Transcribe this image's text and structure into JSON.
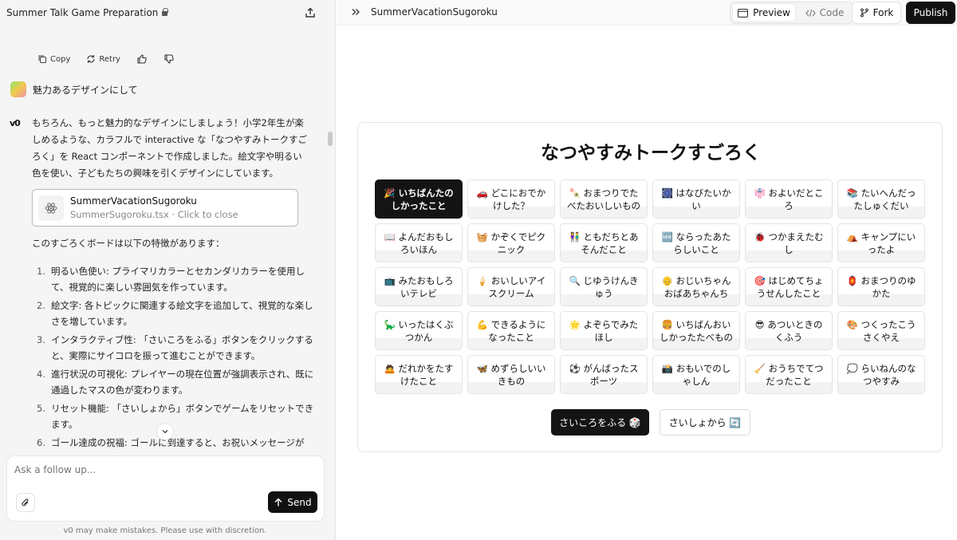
{
  "chat": {
    "title": "Summer Talk Game Preparation",
    "actions": {
      "copy": "Copy",
      "retry": "Retry"
    },
    "user_message": "魅力あるデザインにして",
    "assistant_logo": "v0",
    "assistant_message": "もちろん、もっと魅力的なデザインにしましょう！小学2年生が楽しめるような、カラフルで interactive な「なつやすみトークすごろく」を React コンポーネントで作成しました。絵文字や明るい色を使い、子どもたちの興味を引くデザインにしています。",
    "file_card": {
      "name": "SummerVacationSugoroku",
      "sub": "SummerSugoroku.tsx · Click to close"
    },
    "features_intro": "このすごろくボードは以下の特徴があります：",
    "features": [
      {
        "num": "1.",
        "text": "明るい色使い: プライマリカラーとセカンダリカラーを使用して、視覚的に楽しい雰囲気を作っています。"
      },
      {
        "num": "2.",
        "text": "絵文字: 各トピックに関連する絵文字を追加して、視覚的な楽しさを増しています。"
      },
      {
        "num": "3.",
        "text": "インタラクティブ性: 「さいころをふる」ボタンをクリックすると、実際にサイコロを振って進むことができます。"
      },
      {
        "num": "4.",
        "text": "進行状況の可視化: プレイヤーの現在位置が強調表示され、既に通過したマスの色が変わります。"
      },
      {
        "num": "5.",
        "text": "リセット機能: 「さいしょから」ボタンでゲームをリセットできます。"
      },
      {
        "num": "6.",
        "text": "ゴール達成の祝福: ゴールに到達すると、お祝いメッセージが"
      }
    ],
    "composer_placeholder": "Ask a follow up...",
    "send_label": "Send",
    "disclaimer": "v0 may make mistakes. Please use with discretion."
  },
  "preview": {
    "title": "SummerVacationSugoroku",
    "tabs": {
      "preview": "Preview",
      "code": "Code"
    },
    "fork": "Fork",
    "publish": "Publish",
    "board_title": "なつやすみトークすごろく",
    "cells": [
      "🎉 いちばんたのしかったこと",
      "🚗 どこにおでかけした？",
      "🍡 おまつりでたべたおいしいもの",
      "🎆 はなびたいかい",
      "👘 およいだところ",
      "📚 たいへんだったしゅくだい",
      "📖 よんだおもしろいほん",
      "🧺 かぞくでピクニック",
      "👫 ともだちとあそんだこと",
      "🆕 ならったあたらしいこと",
      "🐞 つかまえたむし",
      "⛺ キャンプにいったよ",
      "📺 みたおもしろいテレビ",
      "🍦 おいしいアイスクリーム",
      "🔍 じゆうけんきゅう",
      "👴 おじいちゃんおばあちゃんち",
      "🎯 はじめてちょうせんしたこと",
      "🏮 おまつりのゆかた",
      "🦕 いったはくぶつかん",
      "💪 できるようになったこと",
      "🌟 よぞらでみたほし",
      "🍔 いちばんおいしかったたべもの",
      "😎 あついときのくふう",
      "🎨 つくったこうさくやえ",
      "🙇 だれかをたすけたこと",
      "🦋 めずらしいいきもの",
      "⚽ がんばったスポーツ",
      "📸 おもいでのしゃしん",
      "🧹 おうちでてつだったこと",
      "💭 らいねんのなつやすみ"
    ],
    "current_cell_index": 0,
    "roll_button": "さいころをふる 🎲",
    "reset_button": "さいしょから 🔄"
  }
}
